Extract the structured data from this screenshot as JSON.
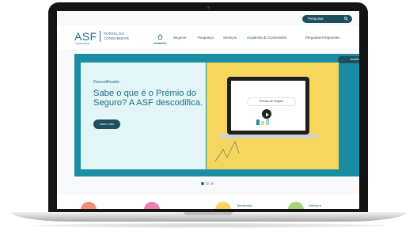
{
  "search": {
    "label": "Pesquisar"
  },
  "logo": {
    "abbr": "ASF",
    "sub": "CONSUMIDOR",
    "line1": "PORTAL DO",
    "line2": "CONSUMIDOR"
  },
  "nav": {
    "items": [
      "Seguros",
      "Poupança",
      "Serviços",
      "Academia do Consumidor",
      "Perguntas Frequentes"
    ]
  },
  "hero": {
    "small": "Descodificador",
    "title": "Sabe o que é o Prémio do Seguro? A ASF descodifica.",
    "button": "Saber mais",
    "top_pill": "Avaliar",
    "mini_bar_label": "Prémio do Seguro"
  },
  "bottom": {
    "labels": [
      "Beneficiário",
      "Verificar a"
    ]
  },
  "colors": {
    "teal_dark": "#1d4f5e",
    "teal": "#1b8ea3",
    "yellow": "#f6d65c",
    "light_teal": "#e3f5f6"
  }
}
